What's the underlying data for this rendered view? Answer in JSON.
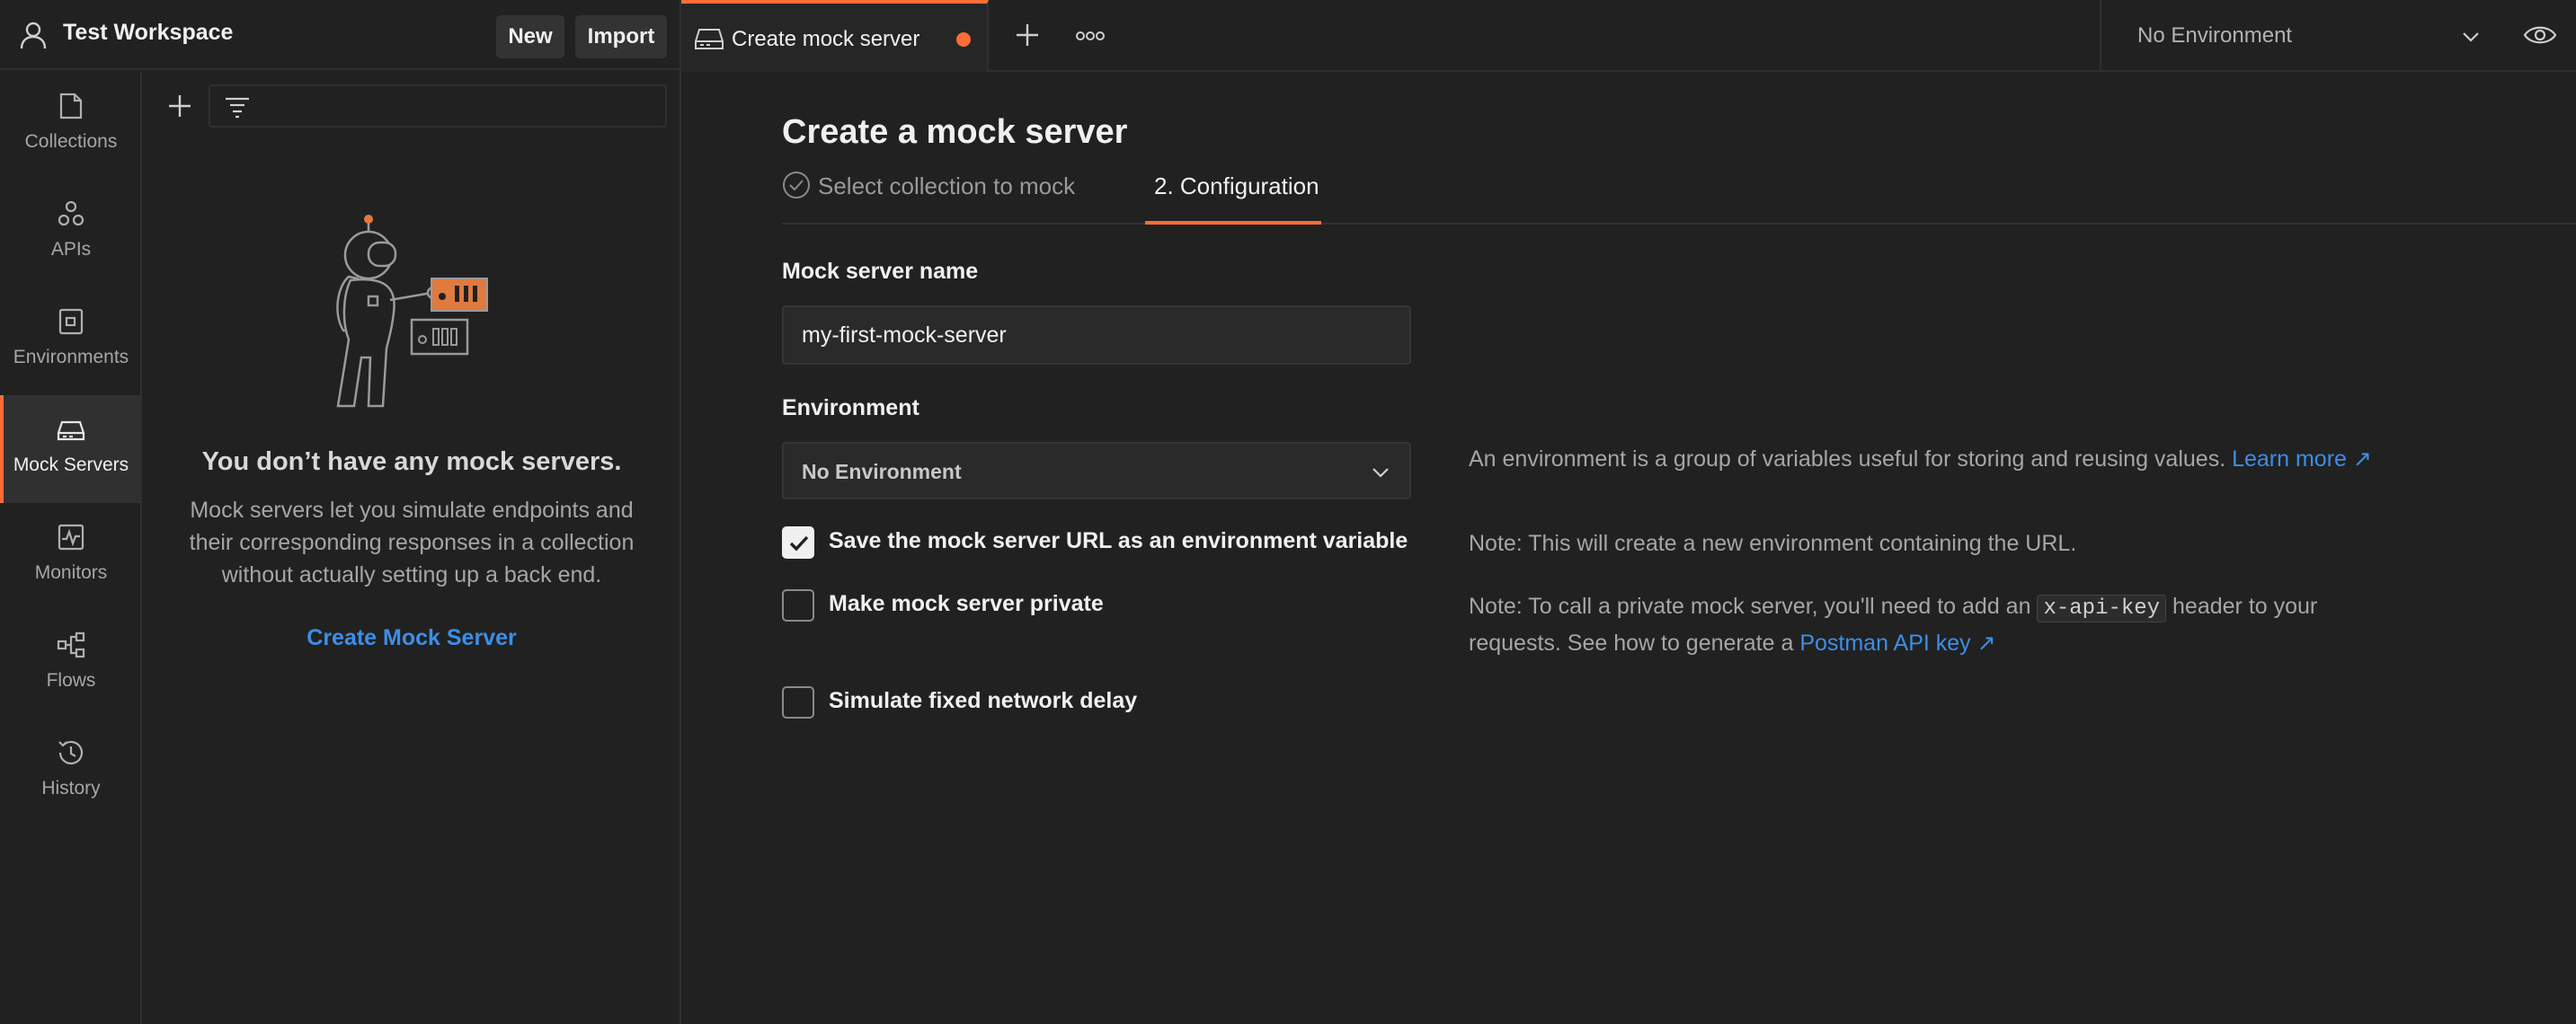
{
  "workspace": {
    "title": "Test Workspace",
    "new_label": "New",
    "import_label": "Import"
  },
  "rail": {
    "items": [
      {
        "label": "Collections",
        "icon": "collections-icon"
      },
      {
        "label": "APIs",
        "icon": "apis-icon"
      },
      {
        "label": "Environments",
        "icon": "environments-icon"
      },
      {
        "label": "Mock Servers",
        "icon": "mock-servers-icon",
        "active": true
      },
      {
        "label": "Monitors",
        "icon": "monitors-icon"
      },
      {
        "label": "Flows",
        "icon": "flows-icon"
      },
      {
        "label": "History",
        "icon": "history-icon"
      }
    ]
  },
  "sidebar": {
    "empty_title": "You don’t have any mock servers.",
    "empty_desc": "Mock servers let you simulate endpoints and their corresponding responses in a collection without actually setting up a back end.",
    "create_link": "Create Mock Server"
  },
  "tabs": {
    "active_tab_label": "Create mock server",
    "environment_selector": "No Environment"
  },
  "main": {
    "title": "Create a mock server",
    "step1_label": "Select collection to mock",
    "step2_label": "2. Configuration",
    "name_label": "Mock server name",
    "name_value": "my-first-mock-server",
    "env_label": "Environment",
    "env_value": "No Environment",
    "env_help": "An environment is a group of variables useful for storing and reusing values.",
    "learn_more": "Learn more ↗",
    "save_url_label": "Save the mock server URL as an environment variable",
    "save_url_checked": true,
    "save_url_note": "Note: This will create a new environment containing the URL.",
    "private_label": "Make mock server private",
    "private_checked": false,
    "private_note_before": "Note: To call a private mock server, you'll need to add an",
    "private_note_code": "x-api-key",
    "private_note_middle": "header to your requests. See how to generate a",
    "private_note_link": "Postman API key ↗",
    "delay_label": "Simulate fixed network delay",
    "delay_checked": false
  },
  "colors": {
    "accent": "#ff6c37",
    "link": "#3d8ee6",
    "background": "#212121"
  }
}
